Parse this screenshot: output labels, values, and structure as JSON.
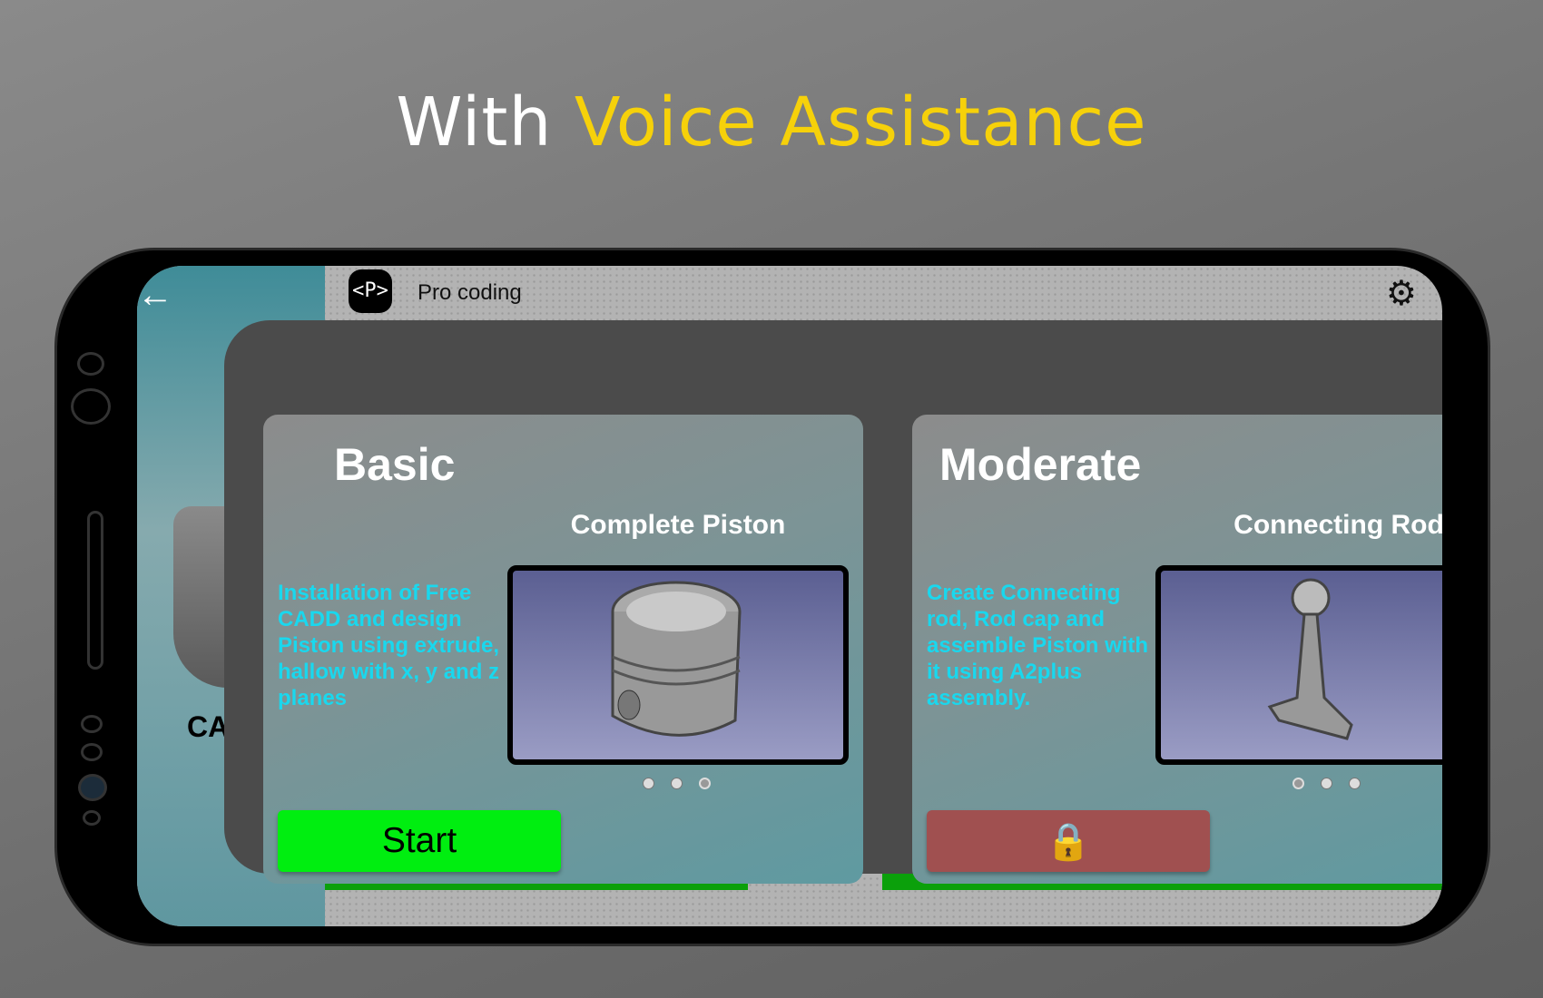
{
  "headline": {
    "prefix": "With",
    "accent": "Voice Assistance"
  },
  "app": {
    "title": "Pro coding",
    "logo": "<P>",
    "back_icon": "arrow-left-icon",
    "settings_icon": "gear-icon",
    "background_label": "CA"
  },
  "colors": {
    "accent": "#f6d10a",
    "description": "#19d8ee",
    "start": "#00ee10",
    "locked": "#a05050"
  },
  "cards": [
    {
      "level": "Basic",
      "project": "Complete Piston",
      "description": "Installation of Free CADD and design Piston using extrude, hallow with x, y and z planes",
      "button": "Start",
      "locked": false,
      "carousel_active": [
        true,
        true,
        false
      ]
    },
    {
      "level": "Moderate",
      "project": "Connecting Rod",
      "description": "Create Connecting rod, Rod cap and assemble Piston with it using A2plus assembly.",
      "button_icon": "lock-icon",
      "locked": true,
      "carousel_active": [
        false,
        true,
        true
      ]
    }
  ]
}
